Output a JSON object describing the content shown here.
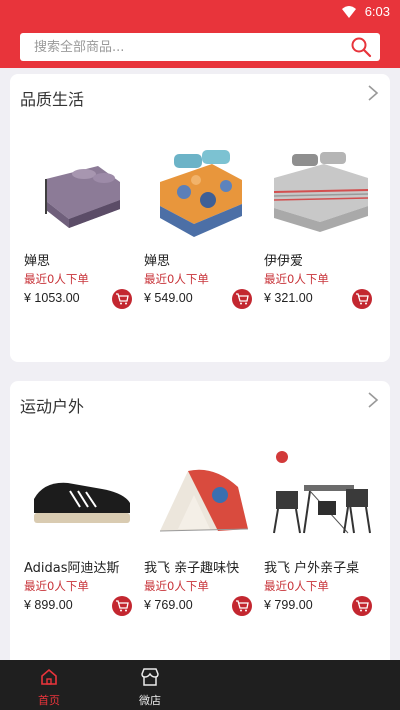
{
  "status_bar": {
    "time": "6:03"
  },
  "search": {
    "placeholder": "搜索全部商品..."
  },
  "sections": [
    {
      "title": "品质生活",
      "products": [
        {
          "name": "婵思",
          "recent": "最近0人下单",
          "price": "¥ 1053.00"
        },
        {
          "name": "婵思",
          "recent": "最近0人下单",
          "price": "¥ 549.00"
        },
        {
          "name": "伊伊爱",
          "recent": "最近0人下单",
          "price": "¥ 321.00"
        }
      ]
    },
    {
      "title": "运动户外",
      "products": [
        {
          "name": "Adidas阿迪达斯",
          "recent": "最近0人下单",
          "price": "¥ 899.00"
        },
        {
          "name": "我飞 亲子趣味快",
          "recent": "最近0人下单",
          "price": "¥ 769.00"
        },
        {
          "name": "我飞 户外亲子桌",
          "recent": "最近0人下单",
          "price": "¥ 799.00"
        }
      ]
    }
  ],
  "tab_bar": {
    "tabs": [
      {
        "label": "首页"
      },
      {
        "label": "微店"
      }
    ]
  },
  "colors": {
    "brand": "#e8343b",
    "cart": "#c32730",
    "tab_bar": "#1f1f1f"
  }
}
